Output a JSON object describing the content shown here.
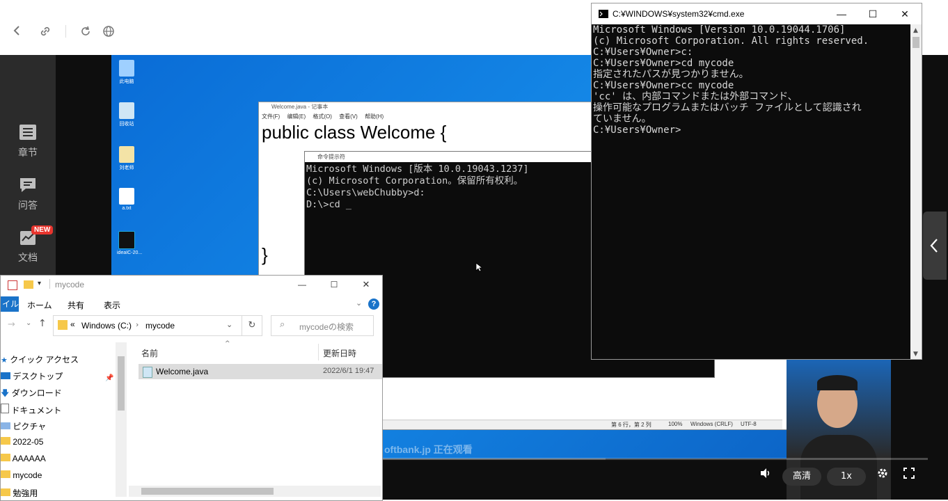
{
  "browser": {
    "back_icon": "chevron-left-icon",
    "link_icon": "link-icon",
    "reload_icon": "reload-icon",
    "globe_icon": "globe-icon"
  },
  "course_sidebar": {
    "items": [
      {
        "label": "章节",
        "icon": "chapter-icon"
      },
      {
        "label": "问答",
        "icon": "qa-icon"
      },
      {
        "label": "文档",
        "icon": "doc-icon",
        "badge": "NEW"
      }
    ]
  },
  "desktop": {
    "icons": [
      {
        "label": "此电脑"
      },
      {
        "label": "回收站"
      },
      {
        "label": "刘老师"
      },
      {
        "label": "a.txt"
      },
      {
        "label": "ideaIC-20..."
      }
    ]
  },
  "notepad": {
    "title": "Welcome.java - 记事本",
    "menu": [
      "文件(F)",
      "编辑(E)",
      "格式(O)",
      "查看(V)",
      "帮助(H)"
    ],
    "code_line1": "public  class  Welcome {",
    "code_close": "}",
    "status": [
      "第 6 行，第 2 列",
      "100%",
      "Windows (CRLF)",
      "UTF-8"
    ]
  },
  "inner_cmd": {
    "title": "命令提示符",
    "lines": [
      "Microsoft Windows [版本 10.0.19043.1237]",
      "(c) Microsoft Corporation。保留所有权利。",
      "",
      "C:\\Users\\webChubby>d:",
      "",
      "D:\\>cd _"
    ]
  },
  "cmd_window": {
    "title": "C:¥WINDOWS¥system32¥cmd.exe",
    "lines": [
      "Microsoft Windows [Version 10.0.19044.1706]",
      "(c) Microsoft Corporation. All rights reserved.",
      "",
      "C:¥Users¥Owner>c:",
      "",
      "C:¥Users¥Owner>cd mycode",
      "指定されたパスが見つかりません。",
      "",
      "C:¥Users¥Owner>cc mycode",
      "'cc' は、内部コマンドまたは外部コマンド、",
      "操作可能なプログラムまたはバッチ ファイルとして認識され",
      "ていません。",
      "",
      "C:¥Users¥Owner>"
    ]
  },
  "explorer": {
    "title": "mycode",
    "ribbon_tabs": [
      "イル",
      "ホーム",
      "共有",
      "表示"
    ],
    "address_parts": [
      "Windows (C:)",
      "mycode"
    ],
    "address_prefix": "«",
    "search_placeholder": "mycodeの検索",
    "columns": {
      "name": "名前",
      "modified": "更新日時"
    },
    "files": [
      {
        "name": "Welcome.java",
        "modified": "2022/6/1 19:47"
      }
    ],
    "nav": [
      {
        "label": "クイック アクセス",
        "icon": "star-icon"
      },
      {
        "label": "デスクトップ",
        "icon": "desktop-icon"
      },
      {
        "label": "ダウンロード",
        "icon": "download-icon"
      },
      {
        "label": "ドキュメント",
        "icon": "document-icon"
      },
      {
        "label": "ピクチャ",
        "icon": "picture-icon"
      },
      {
        "label": "2022-05",
        "icon": "folder-icon"
      },
      {
        "label": "AAAAAA",
        "icon": "folder-icon"
      },
      {
        "label": "mycode",
        "icon": "folder-icon"
      },
      {
        "label": "勉強用",
        "icon": "folder-icon"
      }
    ]
  },
  "player": {
    "watermark": "oftbank.jp 正在观看",
    "quality": "高清",
    "speed": "1x",
    "progress_fraction": 0.41
  },
  "colors": {
    "desktop_blue": "#0a6cd6",
    "explorer_accent": "#1a73c9",
    "badge_red": "#e8352e"
  }
}
